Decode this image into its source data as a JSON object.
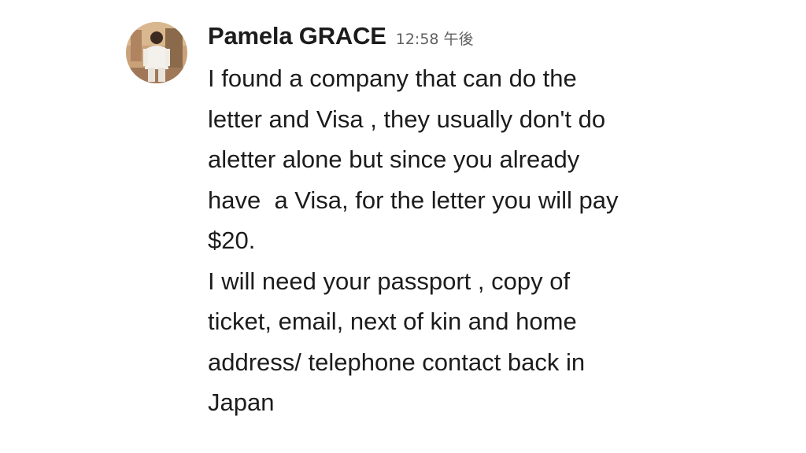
{
  "message": {
    "avatar_icon": "user-photo-avatar",
    "sender": "Pamela GRACE",
    "timestamp": "12:58 午後",
    "lines": [
      "I found a company that can do the",
      "letter and Visa , they usually don't do",
      "aletter alone but since you already",
      "have  a Visa, for the letter you will pay",
      "$20.",
      "I will need your passport , copy of",
      "ticket, email, next of kin and home",
      "address/ telephone contact back in",
      "Japan"
    ]
  }
}
